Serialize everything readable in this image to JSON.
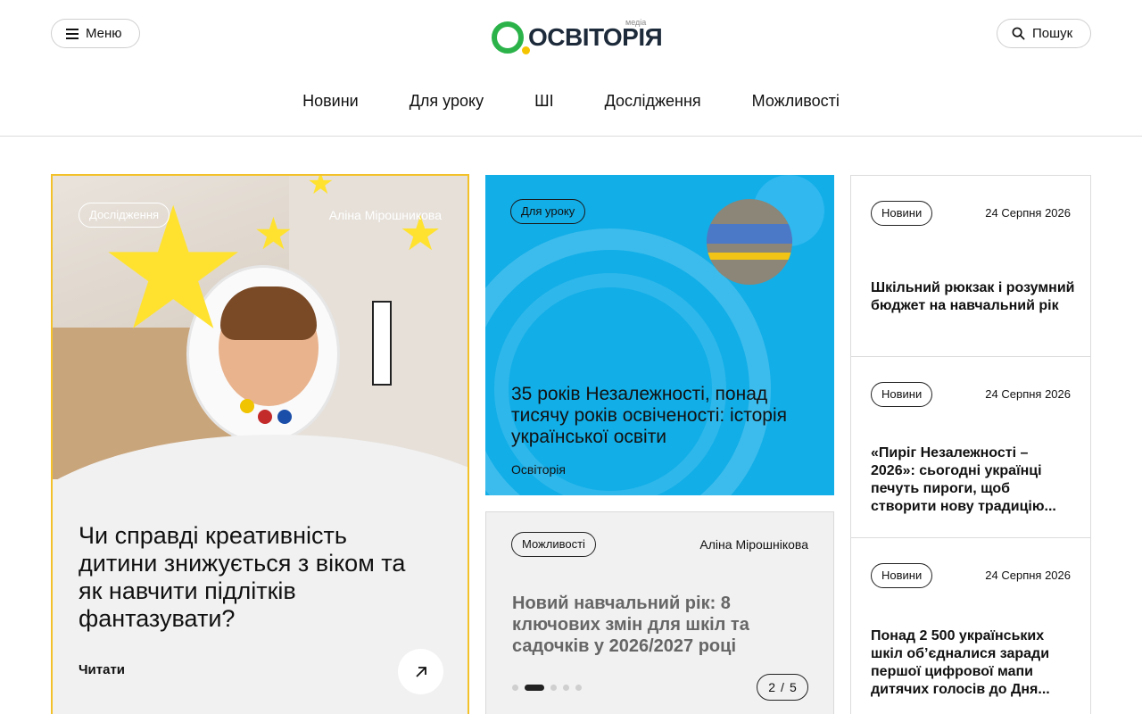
{
  "header": {
    "menu_label": "Меню",
    "search_label": "Пошук",
    "logo_text": "ОСВІТОРІЯ",
    "logo_media": "медіа"
  },
  "nav": [
    {
      "label": "Новини"
    },
    {
      "label": "Для уроку"
    },
    {
      "label": "ШІ"
    },
    {
      "label": "Дослідження"
    },
    {
      "label": "Можливості"
    }
  ],
  "feature": {
    "tag": "Дослідження",
    "author": "Аліна Мірошникова",
    "title": "Чи справді креативність дитини знижується з віком та як навчити підлітків фантазувати?",
    "read_label": "Читати"
  },
  "blue_card": {
    "tag": "Для уроку",
    "title": "35 років Незалежності, понад тисячу років освіченості: історія української освіти",
    "source": "Освіторія"
  },
  "gray_card": {
    "tag": "Можливості",
    "author": "Аліна Мірошнікова",
    "title": "Новий навчальний рік: 8 ключових змін для шкіл та садочків у 2026/2027 році",
    "pager_current": "2",
    "pager_separator": "/",
    "pager_total": "5"
  },
  "news": [
    {
      "tag": "Новини",
      "date": "24 Серпня 2026",
      "title": "Шкільний рюкзак і розумний бюджет на навчальний рік"
    },
    {
      "tag": "Новини",
      "date": "24 Серпня 2026",
      "title": "«Пиріг Незалежності – 2026»: сьогодні українці печуть пироги, щоб створити нову традицію..."
    },
    {
      "tag": "Новини",
      "date": "24 Серпня 2026",
      "title": "Понад 2 500 українських шкіл об’єдналися заради першої цифрової мапи дитячих голосів до Дня..."
    }
  ],
  "colors": {
    "accent_green": "#2bb34a",
    "accent_yellow": "#f5c400",
    "blue_card": "#12aee8",
    "feature_border": "#f3c22b"
  }
}
